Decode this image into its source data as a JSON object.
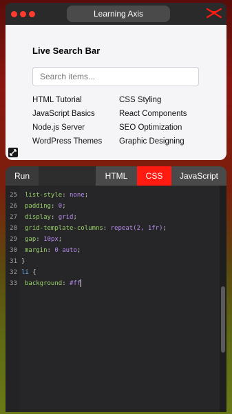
{
  "window": {
    "title": "Learning Axis",
    "accent": "#ff1a12"
  },
  "preview": {
    "heading": "Live Search Bar",
    "search_placeholder": "Search items...",
    "items": [
      "HTML Tutorial",
      "CSS Styling",
      "JavaScript Basics",
      "React Components",
      "Node.js Server",
      "SEO Optimization",
      "WordPress Themes",
      "Graphic Designing"
    ]
  },
  "editor": {
    "tabs": {
      "run": "Run",
      "html": "HTML",
      "css": "CSS",
      "js": "JavaScript"
    },
    "active_tab": "CSS",
    "lines": [
      {
        "n": "25",
        "prop": "list-style",
        "val": "none"
      },
      {
        "n": "26",
        "prop": "padding",
        "val": "0"
      },
      {
        "n": "27",
        "prop": "display",
        "val": "grid"
      },
      {
        "n": "28",
        "prop": "grid-template-columns",
        "val": "repeat(2, 1fr)"
      },
      {
        "n": "29",
        "prop": "gap",
        "val": "10px"
      },
      {
        "n": "30",
        "prop": "margin",
        "val": "0 auto"
      },
      {
        "n": "31",
        "text": "}"
      },
      {
        "n": "32",
        "selector": "li",
        "text": " {"
      },
      {
        "n": "33",
        "prop": "background",
        "val": "#ff"
      }
    ]
  }
}
